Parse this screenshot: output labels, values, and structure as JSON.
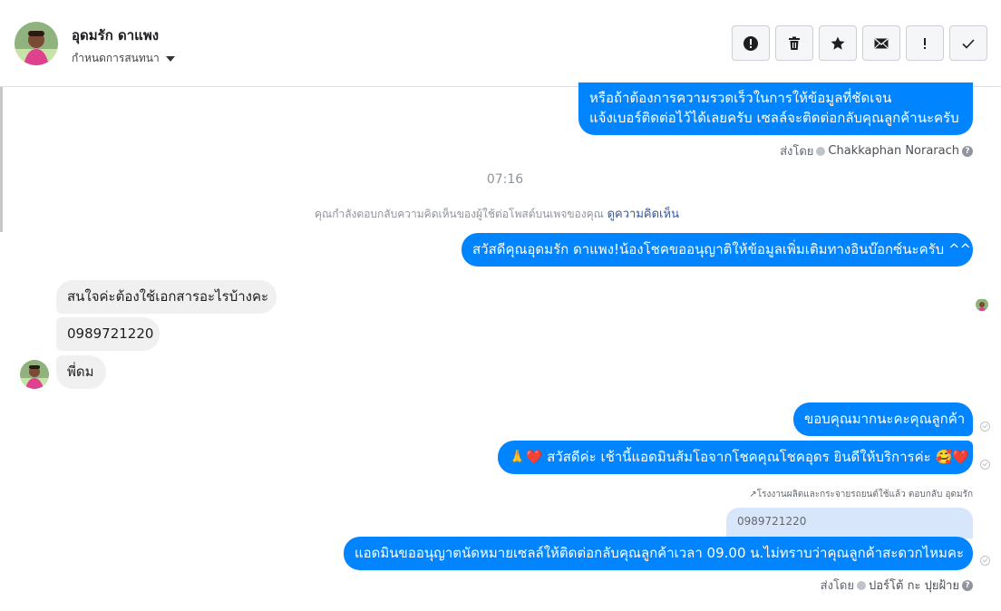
{
  "header": {
    "contact_name": "อุดมรัก ดาแพง",
    "assign_label": "กำหนดการสนทนา"
  },
  "toolbar": {
    "icons": [
      "alert-icon",
      "trash-icon",
      "star-icon",
      "mail-icon",
      "important-icon",
      "check-icon"
    ]
  },
  "messages": {
    "out_1_line1": "หรือถ้าต้องการความรวดเร็วในการให้ข้อมูลที่ชัดเจน",
    "out_1_line2": "แจ้งเบอร์ติดต่อไว้ได้เลยครับ เซลล์จะติดต่อกลับคุณลูกค้านะครับ",
    "sent_by_label": "ส่งโดย",
    "sender_1": "Chakkaphan Norarach",
    "time": "07:16",
    "system_text": "คุณกำลังตอบกลับความคิดเห็นของผู้ใช้ต่อโพสต์บนเพจของคุณ",
    "system_link": "ดูความคิดเห็น",
    "out_2": "สวัสดีคุณอุดมรัก ดาแพง!น้องโชคขออนุญาติให้ข้อมูลเพิ่มเติมทางอินบ๊อกซ์นะครับ ^^",
    "in_1": "สนใจค่ะต้องใช้เอกสารอะไรบ้างคะ",
    "in_2": "0989721220",
    "in_3": "พี่ดม",
    "out_3": "ขอบคุณมากนะคะคุณลูกค้า",
    "out_4": "🙏❤️ สวัสดีค่ะ เช้านี้แอดมินส้มโอจากโชคคุณโชคอุดร ยินดีให้บริการค่ะ 🥰❤️",
    "reply_note": "↗โรงงานผลิตและกระจายรถยนต์ใช้แล้ว ตอบกลับ อุดมรัก",
    "quote_text": "0989721220",
    "out_5": "แอดมินขออนุญาตนัดหมายเซลล์ให้ติดต่อกลับคุณลูกค้าเวลา 09.00 น.ไม่ทราบว่าคุณลูกค้าสะดวกไหมคะ",
    "sender_2": "ปอร์โต้ กะ ปุยฝ้าย",
    "help_glyph": "?"
  },
  "colors": {
    "outgoing": "#0084ff",
    "incoming": "#f1f0f0",
    "quote": "#d8e6fb"
  }
}
